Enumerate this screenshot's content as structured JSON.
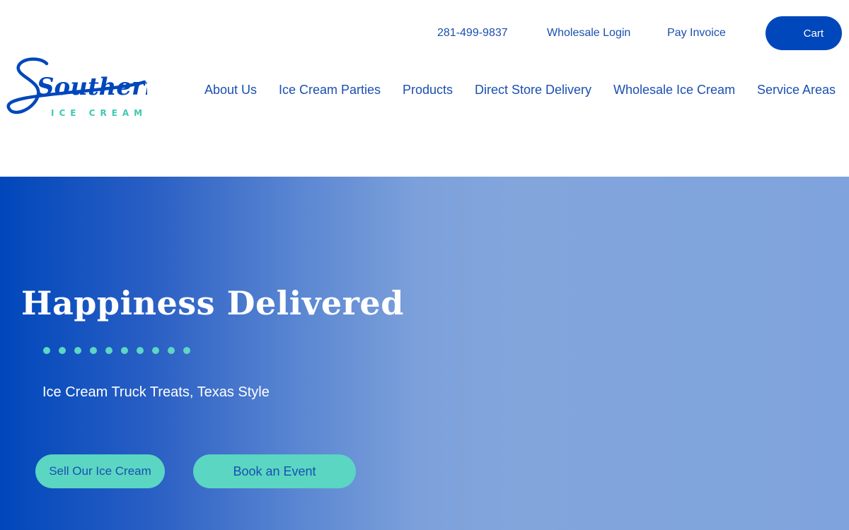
{
  "header": {
    "utility": {
      "phone": "281-499-9837",
      "wholesale_login": "Wholesale Login",
      "pay_invoice": "Pay Invoice",
      "cart": "Cart"
    },
    "logo": {
      "wordmark": "Southern",
      "tagline": "ICE CREAM",
      "colors": {
        "wordmark": "#0047bb",
        "tagline": "#3ec9b0"
      }
    },
    "nav": [
      {
        "label": "About Us"
      },
      {
        "label": "Ice Cream Parties"
      },
      {
        "label": "Products"
      },
      {
        "label": "Direct Store Delivery"
      },
      {
        "label": "Wholesale Ice Cream"
      },
      {
        "label": "Service Areas"
      }
    ]
  },
  "hero": {
    "title": "Happiness Delivered",
    "subtitle": "Ice Cream Truck Treats, Texas Style",
    "buttons": {
      "sell": "Sell Our Ice Cream",
      "book": "Book an Event"
    }
  },
  "colors": {
    "brand_blue": "#0047bb",
    "accent_teal": "#5ad6c2",
    "hero_light": "#82a5dc"
  }
}
